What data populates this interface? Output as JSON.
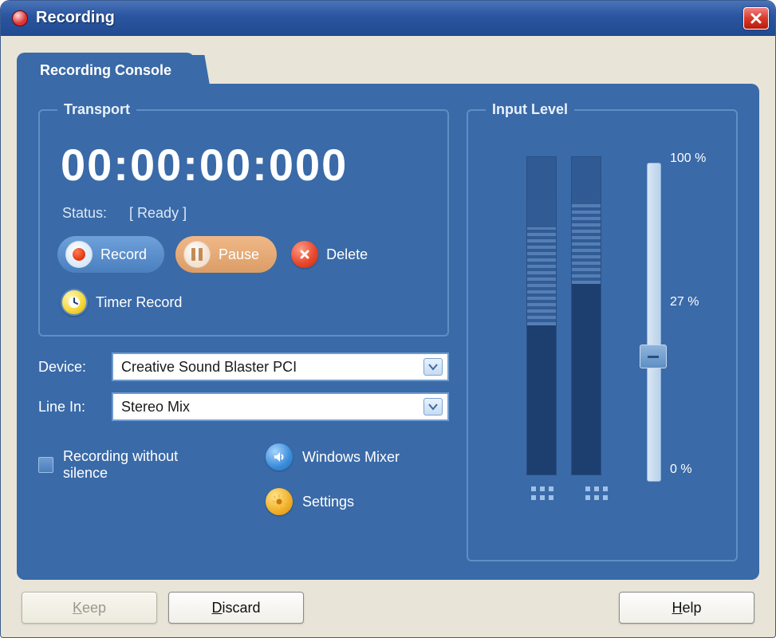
{
  "window": {
    "title": "Recording"
  },
  "tab": {
    "label": "Recording Console"
  },
  "transport": {
    "legend": "Transport",
    "time": "00:00:00:000",
    "status_label": "Status:",
    "status_value": "[ Ready ]",
    "record": "Record",
    "pause": "Pause",
    "delete": "Delete",
    "timer_record": "Timer Record"
  },
  "device": {
    "label": "Device:",
    "value": "Creative Sound Blaster PCI"
  },
  "line_in": {
    "label": "Line In:",
    "value": "Stereo Mix"
  },
  "links": {
    "windows_mixer": "Windows Mixer",
    "settings": "Settings",
    "rec_no_silence": "Recording without silence"
  },
  "input_level": {
    "legend": "Input Level",
    "max_label": "100 %",
    "current_label": "27 %",
    "min_label": "0 %",
    "meter_left_pct": 47,
    "meter_right_pct": 60,
    "meter_left_ghost_start": 47,
    "meter_left_ghost_end": 78,
    "meter_right_ghost_start": 60,
    "meter_right_ghost_end": 86,
    "slider_pos_pct": 27
  },
  "footer": {
    "keep_l": "K",
    "keep_r": "eep",
    "discard_l": "D",
    "discard_r": "iscard",
    "help_l": "H",
    "help_r": "elp"
  }
}
